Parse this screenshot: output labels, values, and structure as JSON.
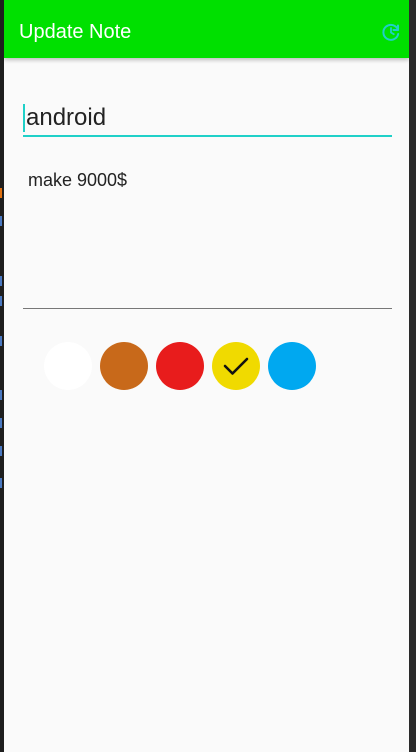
{
  "appbar": {
    "title": "Update Note",
    "refresh_icon": "refresh-icon",
    "color": "#00e000"
  },
  "note": {
    "title_value": "android",
    "body_value": "make 9000$",
    "accent_color": "#1fd0c8"
  },
  "colors": [
    {
      "name": "white",
      "hex": "#ffffff",
      "selected": false
    },
    {
      "name": "brown",
      "hex": "#c8691a",
      "selected": false
    },
    {
      "name": "red",
      "hex": "#e81c1c",
      "selected": false
    },
    {
      "name": "yellow",
      "hex": "#f0da00",
      "selected": true
    },
    {
      "name": "blue",
      "hex": "#00a8f0",
      "selected": false
    }
  ]
}
